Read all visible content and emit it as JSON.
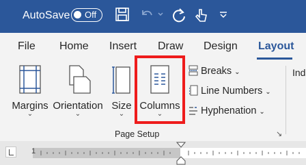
{
  "titlebar": {
    "autosave_label": "AutoSave",
    "autosave_state": "Off",
    "icons": [
      "save-icon",
      "undo-icon",
      "redo-icon",
      "touch-mode-icon",
      "customize-quick-access-icon"
    ]
  },
  "tabs": [
    {
      "label": "File",
      "active": false
    },
    {
      "label": "Home",
      "active": false
    },
    {
      "label": "Insert",
      "active": false
    },
    {
      "label": "Draw",
      "active": false
    },
    {
      "label": "Design",
      "active": false
    },
    {
      "label": "Layout",
      "active": true
    }
  ],
  "page_setup": {
    "group_label": "Page Setup",
    "margins_label": "Margins",
    "orientation_label": "Orientation",
    "size_label": "Size",
    "columns_label": "Columns",
    "breaks_label": "Breaks",
    "line_numbers_label": "Line Numbers",
    "hyphenation_label": "Hyphenation"
  },
  "next_group": {
    "label": "Ind"
  },
  "ruler": {
    "number": "1"
  },
  "colors": {
    "brand": "#2b579a",
    "highlight": "#ee1c1c",
    "ribbon": "#f3f3f3"
  }
}
